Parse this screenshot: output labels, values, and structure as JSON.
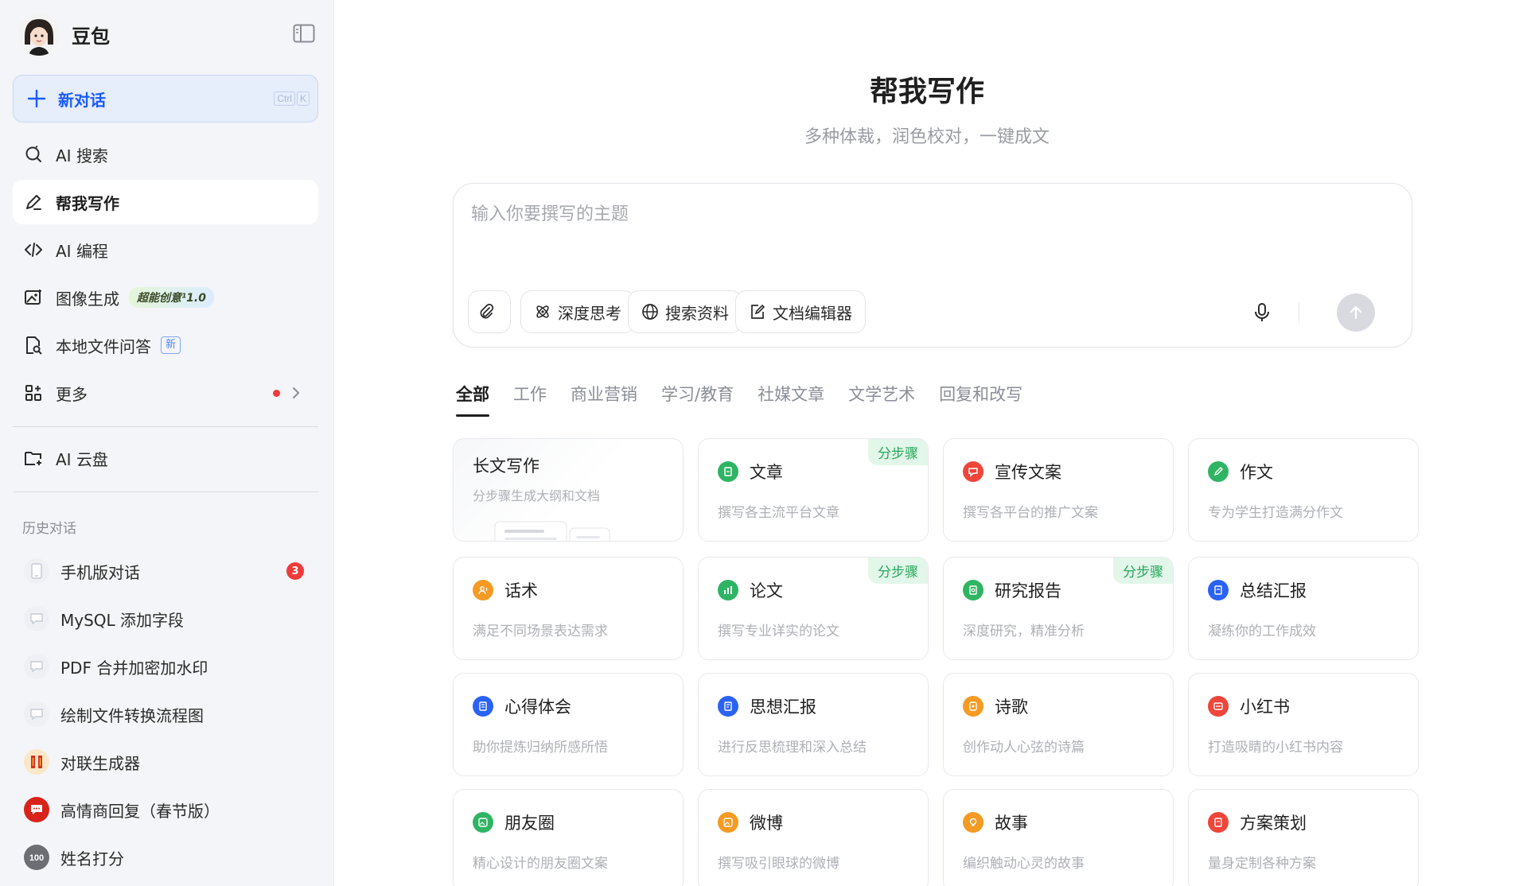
{
  "sidebar": {
    "brand_name": "豆包",
    "new_chat": {
      "label": "新对话",
      "shortcut": [
        "Ctrl",
        "K"
      ]
    },
    "nav": [
      {
        "label": "AI 搜索",
        "icon": "search-icon"
      },
      {
        "label": "帮我写作",
        "icon": "pen-icon",
        "active": true
      },
      {
        "label": "AI 编程",
        "icon": "code-icon"
      },
      {
        "label": "图像生成",
        "icon": "image-icon",
        "pill": "超能创意¹1.0"
      },
      {
        "label": "本地文件问答",
        "icon": "file-search-icon",
        "pill": "新"
      },
      {
        "label": "更多",
        "icon": "apps-icon"
      },
      {
        "label": "AI 云盘",
        "icon": "cloud-drive-icon"
      }
    ],
    "history_title": "历史对话",
    "history": [
      {
        "label": "手机版对话",
        "badge": "3",
        "icon": "phone-icon"
      },
      {
        "label": "MySQL 添加字段",
        "icon": "chat-bubble-icon"
      },
      {
        "label": "PDF 合并加密加水印",
        "icon": "chat-bubble-icon"
      },
      {
        "label": "绘制文件转换流程图",
        "icon": "chat-bubble-icon"
      },
      {
        "label": "对联生成器",
        "icon": "couplet-icon"
      },
      {
        "label": "高情商回复（春节版）",
        "icon": "red-chat-icon"
      },
      {
        "label": "姓名打分",
        "icon": "score-100-icon"
      }
    ]
  },
  "main": {
    "title": "帮我写作",
    "subtitle": "多种体裁，润色校对，一键成文",
    "composer": {
      "placeholder": "输入你要撰写的主题",
      "tools": [
        {
          "label": "深度思考",
          "icon": "atom-icon"
        },
        {
          "label": "搜索资料",
          "icon": "globe-icon"
        },
        {
          "label": "文档编辑器",
          "icon": "edit-doc-icon"
        }
      ]
    },
    "tabs": [
      "全部",
      "工作",
      "商业营销",
      "学习/教育",
      "社媒文章",
      "文学艺术",
      "回复和改写"
    ],
    "cards": [
      {
        "title": "长文写作",
        "desc": "分步骤生成大纲和文档",
        "type": "long"
      },
      {
        "title": "文章",
        "desc": "撰写各主流平台文章",
        "color": "#2fb463",
        "badge": "分步骤",
        "icon": "article-icon"
      },
      {
        "title": "宣传文案",
        "desc": "撰写各平台的推广文案",
        "color": "#f0453a",
        "icon": "megaphone-icon"
      },
      {
        "title": "作文",
        "desc": "专为学生打造满分作文",
        "color": "#2fb463",
        "icon": "pencil-icon"
      },
      {
        "title": "话术",
        "desc": "满足不同场景表达需求",
        "color": "#f59a23",
        "icon": "speech-icon"
      },
      {
        "title": "论文",
        "desc": "撰写专业详实的论文",
        "color": "#2fb463",
        "badge": "分步骤",
        "icon": "chart-icon"
      },
      {
        "title": "研究报告",
        "desc": "深度研究，精准分析",
        "color": "#2fb463",
        "badge": "分步骤",
        "icon": "report-icon"
      },
      {
        "title": "总结汇报",
        "desc": "凝练你的工作成效",
        "color": "#2a62f4",
        "icon": "summary-icon"
      },
      {
        "title": "心得体会",
        "desc": "助你提炼归纳所感所悟",
        "color": "#2a62f4",
        "icon": "notebook-icon"
      },
      {
        "title": "思想汇报",
        "desc": "进行反思梳理和深入总结",
        "color": "#2a62f4",
        "icon": "thought-icon"
      },
      {
        "title": "诗歌",
        "desc": "创作动人心弦的诗篇",
        "color": "#f59a23",
        "icon": "poem-icon"
      },
      {
        "title": "小红书",
        "desc": "打造吸睛的小红书内容",
        "color": "#f0453a",
        "icon": "redbook-icon"
      },
      {
        "title": "朋友圈",
        "desc": "精心设计的朋友圈文案",
        "color": "#2fb463",
        "icon": "moments-icon"
      },
      {
        "title": "微博",
        "desc": "撰写吸引眼球的微博",
        "color": "#f59a23",
        "icon": "weibo-icon"
      },
      {
        "title": "故事",
        "desc": "编织触动心灵的故事",
        "color": "#f59a23",
        "icon": "bulb-icon"
      },
      {
        "title": "方案策划",
        "desc": "量身定制各种方案",
        "color": "#f0453a",
        "icon": "plan-icon"
      }
    ]
  }
}
